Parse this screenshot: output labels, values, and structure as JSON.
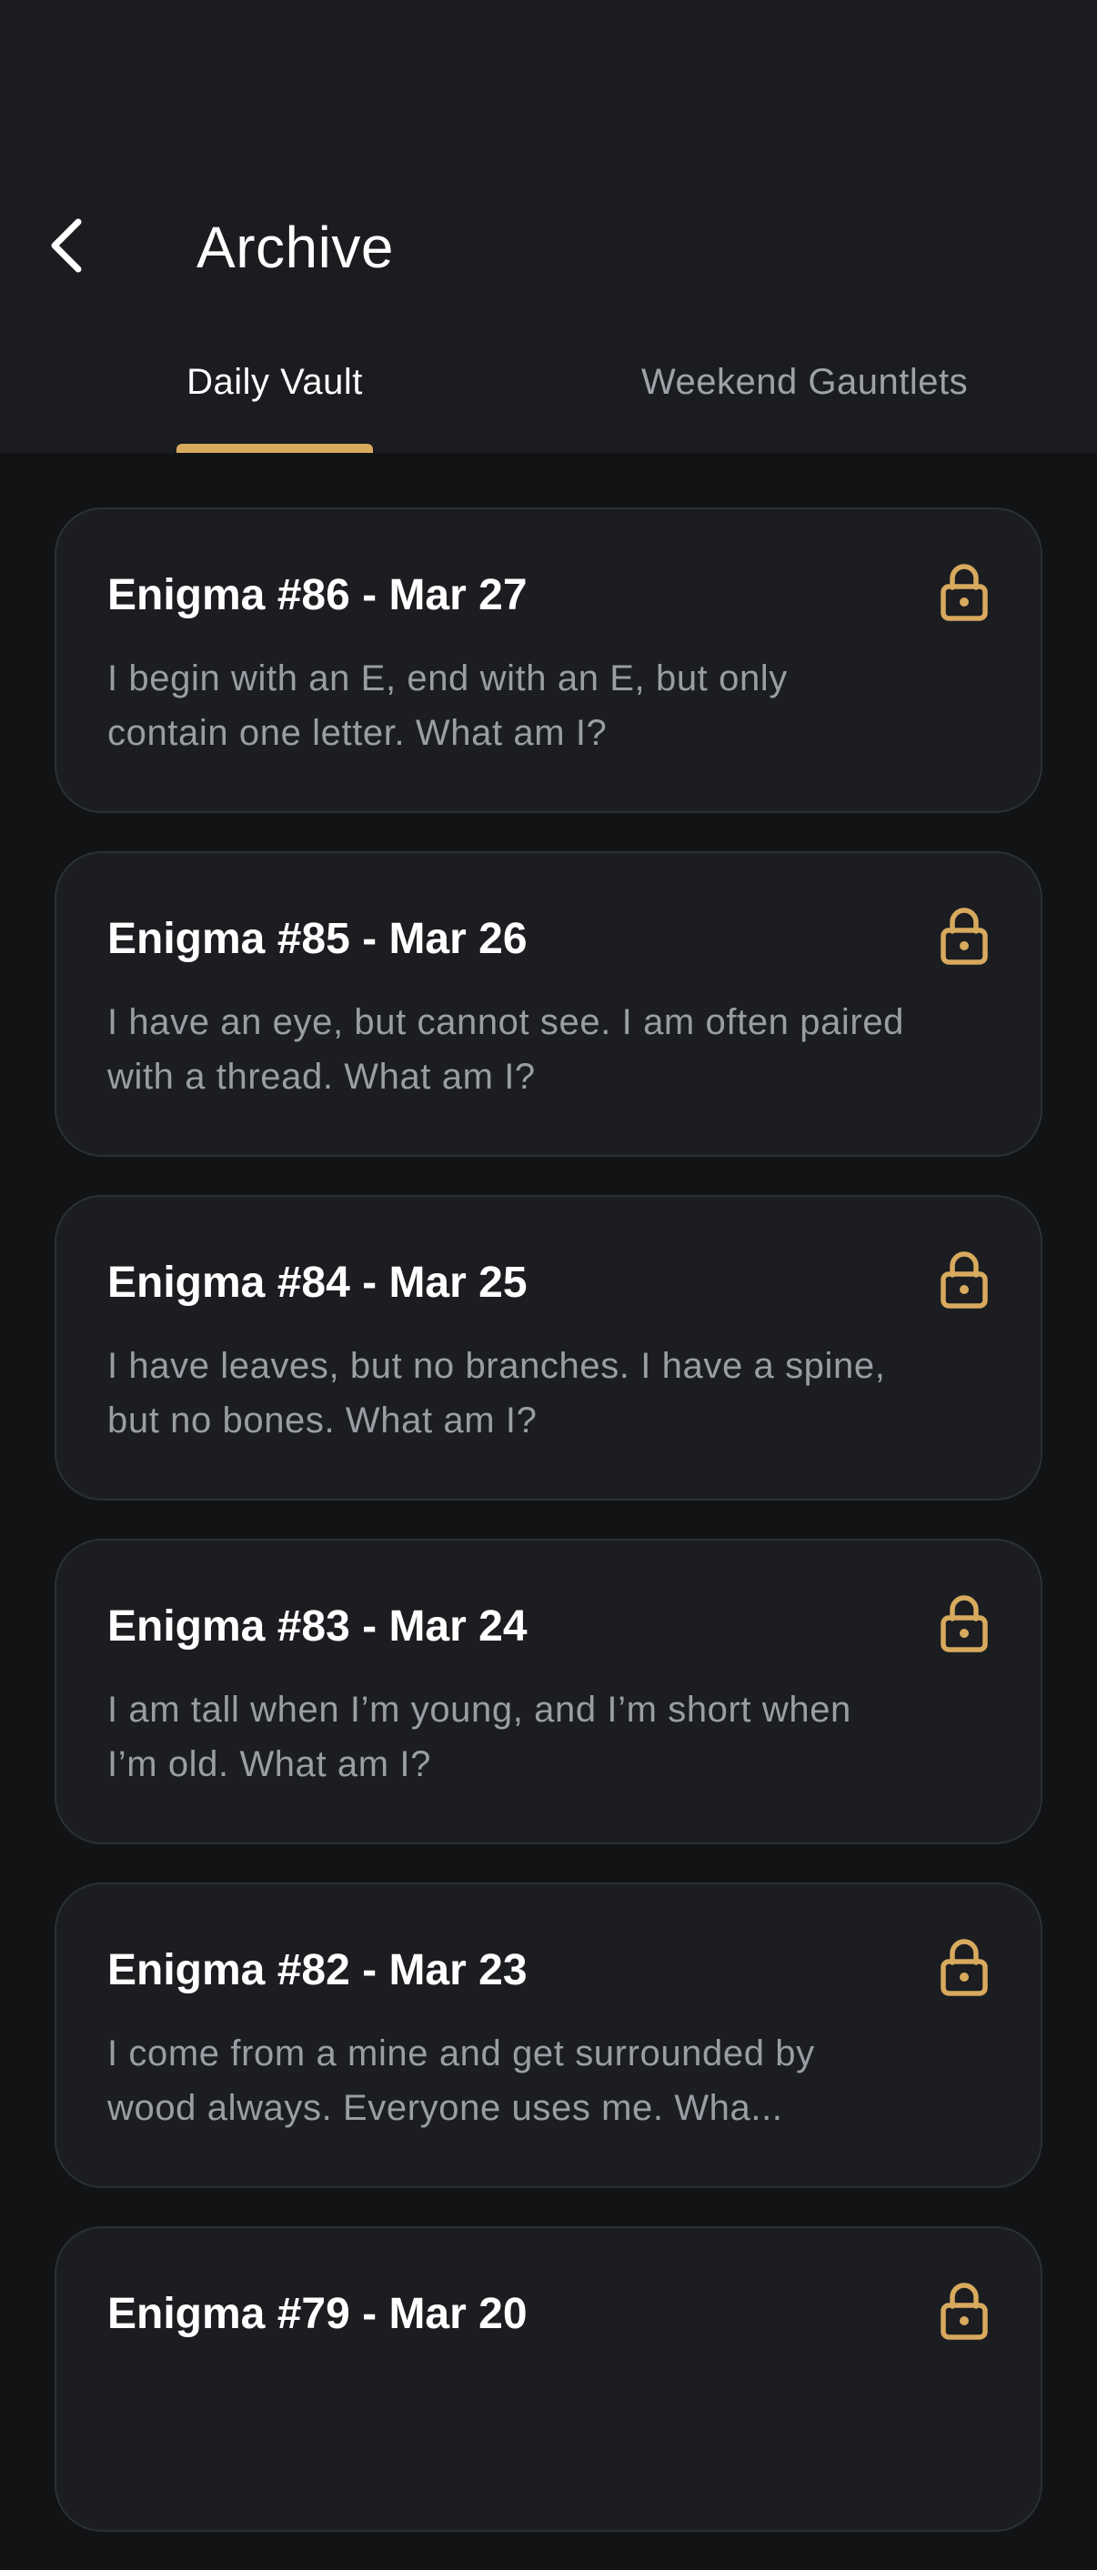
{
  "header": {
    "title": "Archive",
    "back_icon": "chevron-left-icon"
  },
  "tabs": [
    {
      "label": "Daily Vault",
      "active": true
    },
    {
      "label": "Weekend Gauntlets",
      "active": false
    }
  ],
  "colors": {
    "accent": "#d8aa5e",
    "header_bg": "#1a1c20",
    "page_bg": "#111315",
    "card_bg": "#1b1d21",
    "muted_text": "#9a9da3"
  },
  "cards": [
    {
      "title": "Enigma #86 - Mar 27",
      "text": "I begin with an E, end with an E, but only contain one letter. What am I?",
      "icon": "lock-icon"
    },
    {
      "title": "Enigma #85 - Mar 26",
      "text": "I have an eye, but cannot see. I am often paired with a thread. What am I?",
      "icon": "lock-icon"
    },
    {
      "title": "Enigma #84 - Mar 25",
      "text": "I have leaves, but no branches. I have a spine, but no bones. What am I?",
      "icon": "lock-icon"
    },
    {
      "title": "Enigma #83 - Mar 24",
      "text": "I am tall when I’m young, and I’m short when I’m old. What am I?",
      "icon": "lock-icon"
    },
    {
      "title": "Enigma #82 - Mar 23",
      "text": "I come from a mine and get surrounded by wood always. Everyone uses me. Wha...",
      "icon": "lock-icon"
    },
    {
      "title": "Enigma #79 - Mar 20",
      "text": "",
      "icon": "lock-icon"
    }
  ]
}
